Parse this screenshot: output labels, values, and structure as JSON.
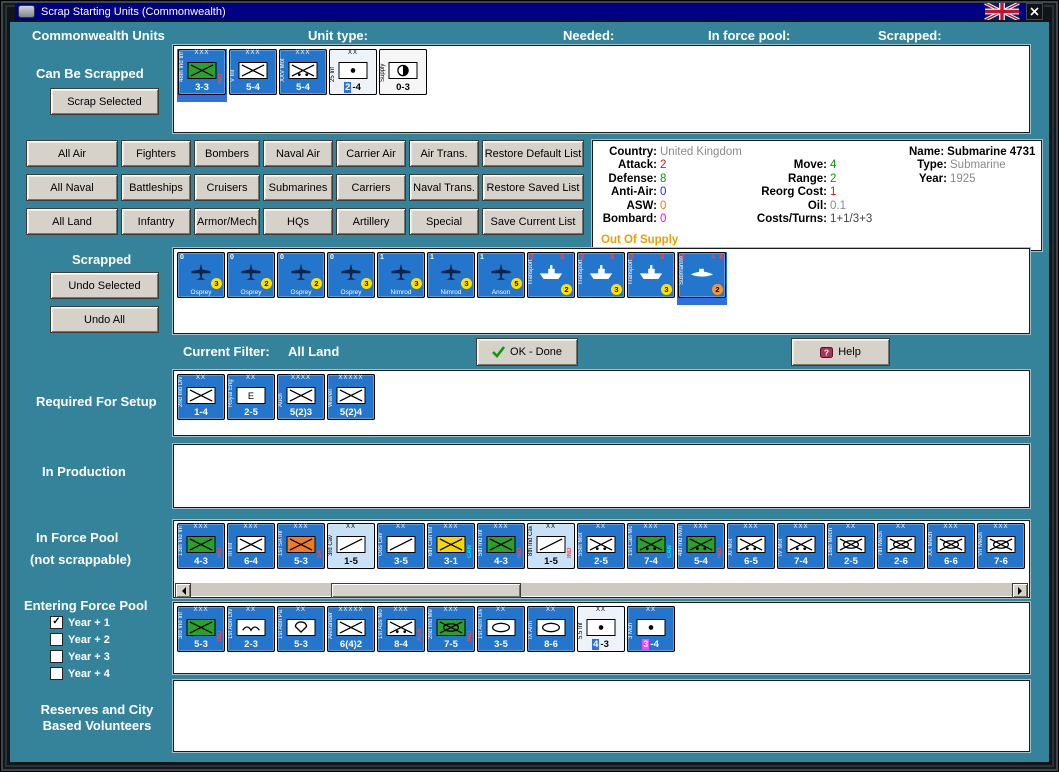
{
  "window": {
    "title": "Scrap Starting Units (Commonwealth)"
  },
  "header": {
    "units": "Commonwealth Units",
    "unit_type": "Unit type:",
    "needed": "Needed:",
    "in_force_pool": "In force pool:",
    "scrapped": "Scrapped:"
  },
  "sections": {
    "can_be_scrapped": {
      "label": "Can Be Scrapped",
      "button": "Scrap Selected",
      "units": [
        {
          "top": "XXX",
          "side": "48th Ind Inf",
          "sym": "inf",
          "symBg": "#2ba12b",
          "stats": "3-3",
          "badge": {
            "text": "IND",
            "color": "#ff4545"
          },
          "selected": true
        },
        {
          "top": "XXX",
          "side": "V Inf",
          "sym": "inf",
          "stats": "5-4"
        },
        {
          "top": "XXX",
          "side": "XXV Mot",
          "sym": "mot",
          "stats": "5-4"
        },
        {
          "top": "XX",
          "side": "25 Inf",
          "sym": "art",
          "bg": "#eef3fa",
          "fg": "#000000",
          "stats": [
            {
              "t": "2",
              "bg": "#2f6fe0",
              "fg": "#ffffff"
            },
            {
              "t": "-4"
            }
          ]
        },
        {
          "side": "Supply",
          "sym": "supply",
          "bg": "#f6f6f6",
          "fg": "#000000",
          "stats": "0-3"
        }
      ]
    },
    "filters": {
      "rows": [
        [
          "All Air",
          "Fighters",
          "Bombers",
          "Naval Air",
          "Carrier Air",
          "Air Trans.",
          "Restore Default List"
        ],
        [
          "All Naval",
          "Battleships",
          "Cruisers",
          "Submarines",
          "Carriers",
          "Naval Trans.",
          "Restore Saved List"
        ],
        [
          "All Land",
          "Infantry",
          "Armor/Mech",
          "HQs",
          "Artillery",
          "Special",
          "Save Current List"
        ]
      ]
    },
    "info": {
      "left": [
        {
          "l": "Country:",
          "v": "United Kingdom",
          "c": "#8a8a8a"
        },
        {
          "l": "Attack:",
          "v": "2",
          "c": "#dd1111"
        },
        {
          "l": "Defense:",
          "v": "8",
          "c": "#00a000"
        },
        {
          "l": "Anti-Air:",
          "v": "0",
          "c": "#2222ff"
        },
        {
          "l": "ASW:",
          "v": "0",
          "c": "#e08200"
        },
        {
          "l": "Bombard:",
          "v": "0",
          "c": "#ff00ff"
        }
      ],
      "mid": [
        {
          "l": "",
          "v": ""
        },
        {
          "l": "Move:",
          "v": "4",
          "c": "#00a000"
        },
        {
          "l": "Range:",
          "v": "2",
          "c": "#00a000"
        },
        {
          "l": "Reorg Cost:",
          "v": "1",
          "c": "#dd1111"
        },
        {
          "l": "Oil:",
          "v": "0.1",
          "c": "#8a8a8a"
        },
        {
          "l": "Costs/Turns:",
          "v": "1+1/3+3",
          "c": "#444444"
        }
      ],
      "right": [
        {
          "l": "Name:",
          "v": "Submarine 4731",
          "c": "#000000",
          "b": true
        },
        {
          "l": "Type:",
          "v": "Submarine",
          "c": "#8a8a8a"
        },
        {
          "l": "Year:",
          "v": "1925",
          "c": "#8a8a8a"
        }
      ],
      "out_of_supply": {
        "text": "Out Of Supply",
        "color": "#e8a000"
      }
    },
    "scrapped": {
      "label": "Scrapped",
      "undo_selected": "Undo Selected",
      "undo_all": "Undo All",
      "units": [
        {
          "kind": "air",
          "name": "Osprey",
          "nums": {
            "tl": "0",
            "circ": "3"
          }
        },
        {
          "kind": "air",
          "name": "Osprey",
          "nums": {
            "tl": "0",
            "circ": "2"
          }
        },
        {
          "kind": "air",
          "name": "Osprey",
          "nums": {
            "tl": "0",
            "circ": "2"
          }
        },
        {
          "kind": "air",
          "name": "Osprey",
          "nums": {
            "tl": "0",
            "circ": "3"
          }
        },
        {
          "kind": "air",
          "name": "Nimrod",
          "nums": {
            "tl": "1",
            "circ": "3"
          }
        },
        {
          "kind": "air",
          "name": "Nimrod",
          "nums": {
            "tl": "1",
            "circ": "3"
          }
        },
        {
          "kind": "air",
          "name": "Anson",
          "nums": {
            "tl": "1",
            "circ": "5"
          }
        },
        {
          "kind": "ship",
          "sym": "ship",
          "side": "Transport",
          "nums": {
            "tl": "0",
            "tlColor": "#ff4545",
            "tr": "3",
            "circ": "2"
          }
        },
        {
          "kind": "ship",
          "sym": "ship",
          "side": "Transport",
          "nums": {
            "tl": "3",
            "tlColor": "#ff4545",
            "tr": "3",
            "circ": "3"
          }
        },
        {
          "kind": "ship",
          "sym": "ship",
          "side": "Transport",
          "nums": {
            "tl": "0",
            "tlColor": "#ff4545",
            "tr": "3",
            "circ": "3"
          }
        },
        {
          "kind": "ship",
          "sym": "sub",
          "side": "Submarine",
          "nums": {
            "tl": "2",
            "tlColor": "#ff4545",
            "tr": "4",
            "tr2": "8",
            "circ": "2",
            "circColor": "#ff9420"
          },
          "selected": true
        }
      ]
    },
    "filter_bar": {
      "label": "Current Filter:",
      "value": "All Land",
      "ok": "OK - Done",
      "help": "Help"
    },
    "required": {
      "label": "Required For Setup",
      "units": [
        {
          "top": "XX",
          "side": "2nd Ind Div",
          "sym": "inf",
          "stats": "1-4"
        },
        {
          "top": "XX",
          "side": "Royal Eng",
          "sym": "eng",
          "stats": "2-5"
        },
        {
          "top": "XXXX",
          "side": "Auch",
          "sym": "inf",
          "stats": "5(2)3"
        },
        {
          "top": "XXXXX",
          "side": "Wavell",
          "sym": "inf",
          "stats": "5(2)4"
        }
      ]
    },
    "production": {
      "label": "In Production"
    },
    "force_pool": {
      "label": "In Force Pool",
      "sub": "(not scrappable)",
      "units": [
        {
          "top": "XXX",
          "side": "13th Ind Inf",
          "sym": "inf",
          "symBg": "#2ba12b",
          "stats": "4-3",
          "badge": {
            "text": "IND",
            "color": "#ff4545"
          }
        },
        {
          "top": "XXX",
          "side": "III Inf",
          "sym": "inf",
          "stats": "6-4"
        },
        {
          "top": "XXX",
          "side": "1st SA Inf",
          "sym": "inf",
          "symBg": "#ef7d1f",
          "stats": "5-3",
          "badge": {
            "text": "SA",
            "color": "#ff4545"
          }
        },
        {
          "top": "XX",
          "side": "3rd Cav",
          "sym": "cav",
          "bg": "#c9e1f6",
          "fg": "#000000",
          "stats": "1-5"
        },
        {
          "top": "XX",
          "side": "Gds Cav",
          "sym": "cav",
          "stats": "3-5"
        },
        {
          "top": "XXX",
          "side": "6th Can Inf",
          "sym": "inf",
          "symBg": "#f5d800",
          "stats": "3-1",
          "badge": {
            "text": "CAN",
            "color": "#00e8e8"
          }
        },
        {
          "top": "XXX",
          "side": "5th Ind Inf",
          "sym": "inf",
          "symBg": "#2ba12b",
          "stats": "4-3",
          "badge": {
            "text": "IND",
            "color": "#ff4545"
          }
        },
        {
          "top": "XX",
          "side": "8th Ind Cav",
          "sym": "cav",
          "bg": "#c9e1f6",
          "fg": "#000000",
          "stats": "1-5",
          "badge": {
            "text": "IND",
            "color": "#ff4545"
          }
        },
        {
          "top": "XX",
          "side": "55th Mot",
          "sym": "mot",
          "stats": "2-5"
        },
        {
          "top": "XXX",
          "side": "1st Can Mot",
          "sym": "mot",
          "symBg": "#2ba12b",
          "stats": "7-4",
          "badge": {
            "text": "CAN",
            "color": "#00e8e8"
          }
        },
        {
          "top": "XXX",
          "side": "4th Ind Mot",
          "sym": "mot",
          "symBg": "#2ba12b",
          "stats": "5-4",
          "badge": {
            "text": "IND",
            "color": "#ff4545"
          }
        },
        {
          "top": "XXX",
          "side": "XI Mot",
          "sym": "mot",
          "stats": "6-5"
        },
        {
          "top": "XXX",
          "side": "IV Mot",
          "sym": "mot",
          "stats": "7-4"
        },
        {
          "top": "XX",
          "side": "18th Mech",
          "sym": "mech",
          "stats": "2-5"
        },
        {
          "top": "XX",
          "side": "7th Mech",
          "sym": "mech",
          "stats": "2-6"
        },
        {
          "top": "XXX",
          "side": "XX Mech",
          "sym": "mech",
          "stats": "6-6"
        },
        {
          "top": "XXX",
          "side": "VII Mech",
          "sym": "mech",
          "stats": "7-6"
        }
      ]
    },
    "entering": {
      "label": "Entering Force Pool",
      "checkboxes": [
        {
          "label": "Year + 1",
          "checked": true
        },
        {
          "label": "Year + 2",
          "checked": false
        },
        {
          "label": "Year + 3",
          "checked": false
        },
        {
          "label": "Year + 4",
          "checked": false
        }
      ],
      "units": [
        {
          "top": "XXX",
          "side": "3rd Ind Inf",
          "sym": "inf",
          "symBg": "#2ba12b",
          "stats": "5-3",
          "badge": {
            "text": "IND",
            "color": "#ff4545"
          }
        },
        {
          "top": "XX",
          "side": "1st Abn Div",
          "sym": "abn",
          "stats": "2-3"
        },
        {
          "top": "XX",
          "side": "1st Abn Pa.",
          "sym": "para",
          "stats": "5-3"
        },
        {
          "top": "XXXXX",
          "side": "Alexander",
          "sym": "inf",
          "stats": "6(4)2"
        },
        {
          "top": "XXX",
          "side": "1st Aus Mot",
          "sym": "mot",
          "stats": "8-4",
          "badge": {
            "text": "AUS",
            "color": "#ff4545"
          }
        },
        {
          "top": "XXX",
          "side": "2nd Ind Mech",
          "sym": "mech",
          "symBg": "#2ba12b",
          "stats": "7-5",
          "badge": {
            "text": "IND",
            "color": "#ff4545"
          }
        },
        {
          "top": "XX",
          "side": "1st Arm Div",
          "sym": "arm",
          "stats": "3-5"
        },
        {
          "top": "XX",
          "side": "IX Arm",
          "sym": "arm",
          "stats": "8-6"
        },
        {
          "top": "XX",
          "side": "5.5 Inf",
          "sym": "art",
          "bg": "#eef3fa",
          "fg": "#000000",
          "stats": [
            {
              "t": "4",
              "bg": "#2f6fe0",
              "fg": "#ffffff"
            },
            {
              "t": "-3"
            }
          ]
        },
        {
          "top": "XX",
          "side": "3 Mch",
          "sym": "art",
          "stats": [
            {
              "t": "3",
              "bg": "#ff40ff",
              "fg": "#ffffff"
            },
            {
              "t": "-4"
            }
          ]
        }
      ]
    },
    "reserves": {
      "label": "Reserves and City Based Volunteers"
    }
  }
}
